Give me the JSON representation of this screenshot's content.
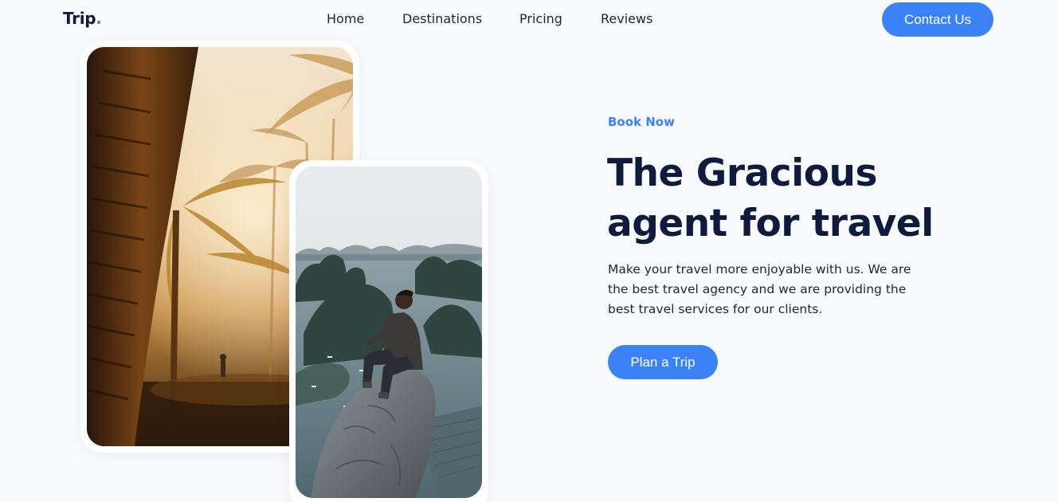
{
  "brand": {
    "name": "Trip",
    "dot": ".",
    "accent_color": "#3b82f6"
  },
  "nav": {
    "items": [
      {
        "label": "Home"
      },
      {
        "label": "Destinations"
      },
      {
        "label": "Pricing"
      },
      {
        "label": "Reviews"
      }
    ],
    "contact_label": "Contact Us"
  },
  "hero": {
    "eyebrow": "Book Now",
    "headline_line1": "The Gracious",
    "headline_line2": "agent for travel",
    "description": "Make your travel more enjoyable with us. We are the best travel agency and we are providing the best travel services for our clients.",
    "cta_label": "Plan a Trip"
  },
  "images": [
    {
      "subject": "palm-forest-sunset-photo"
    },
    {
      "subject": "man-on-rock-bay-view-photo"
    }
  ],
  "colors": {
    "primary": "#3b82f6",
    "heading": "#0f1b3d",
    "background": "#f8fafd"
  }
}
